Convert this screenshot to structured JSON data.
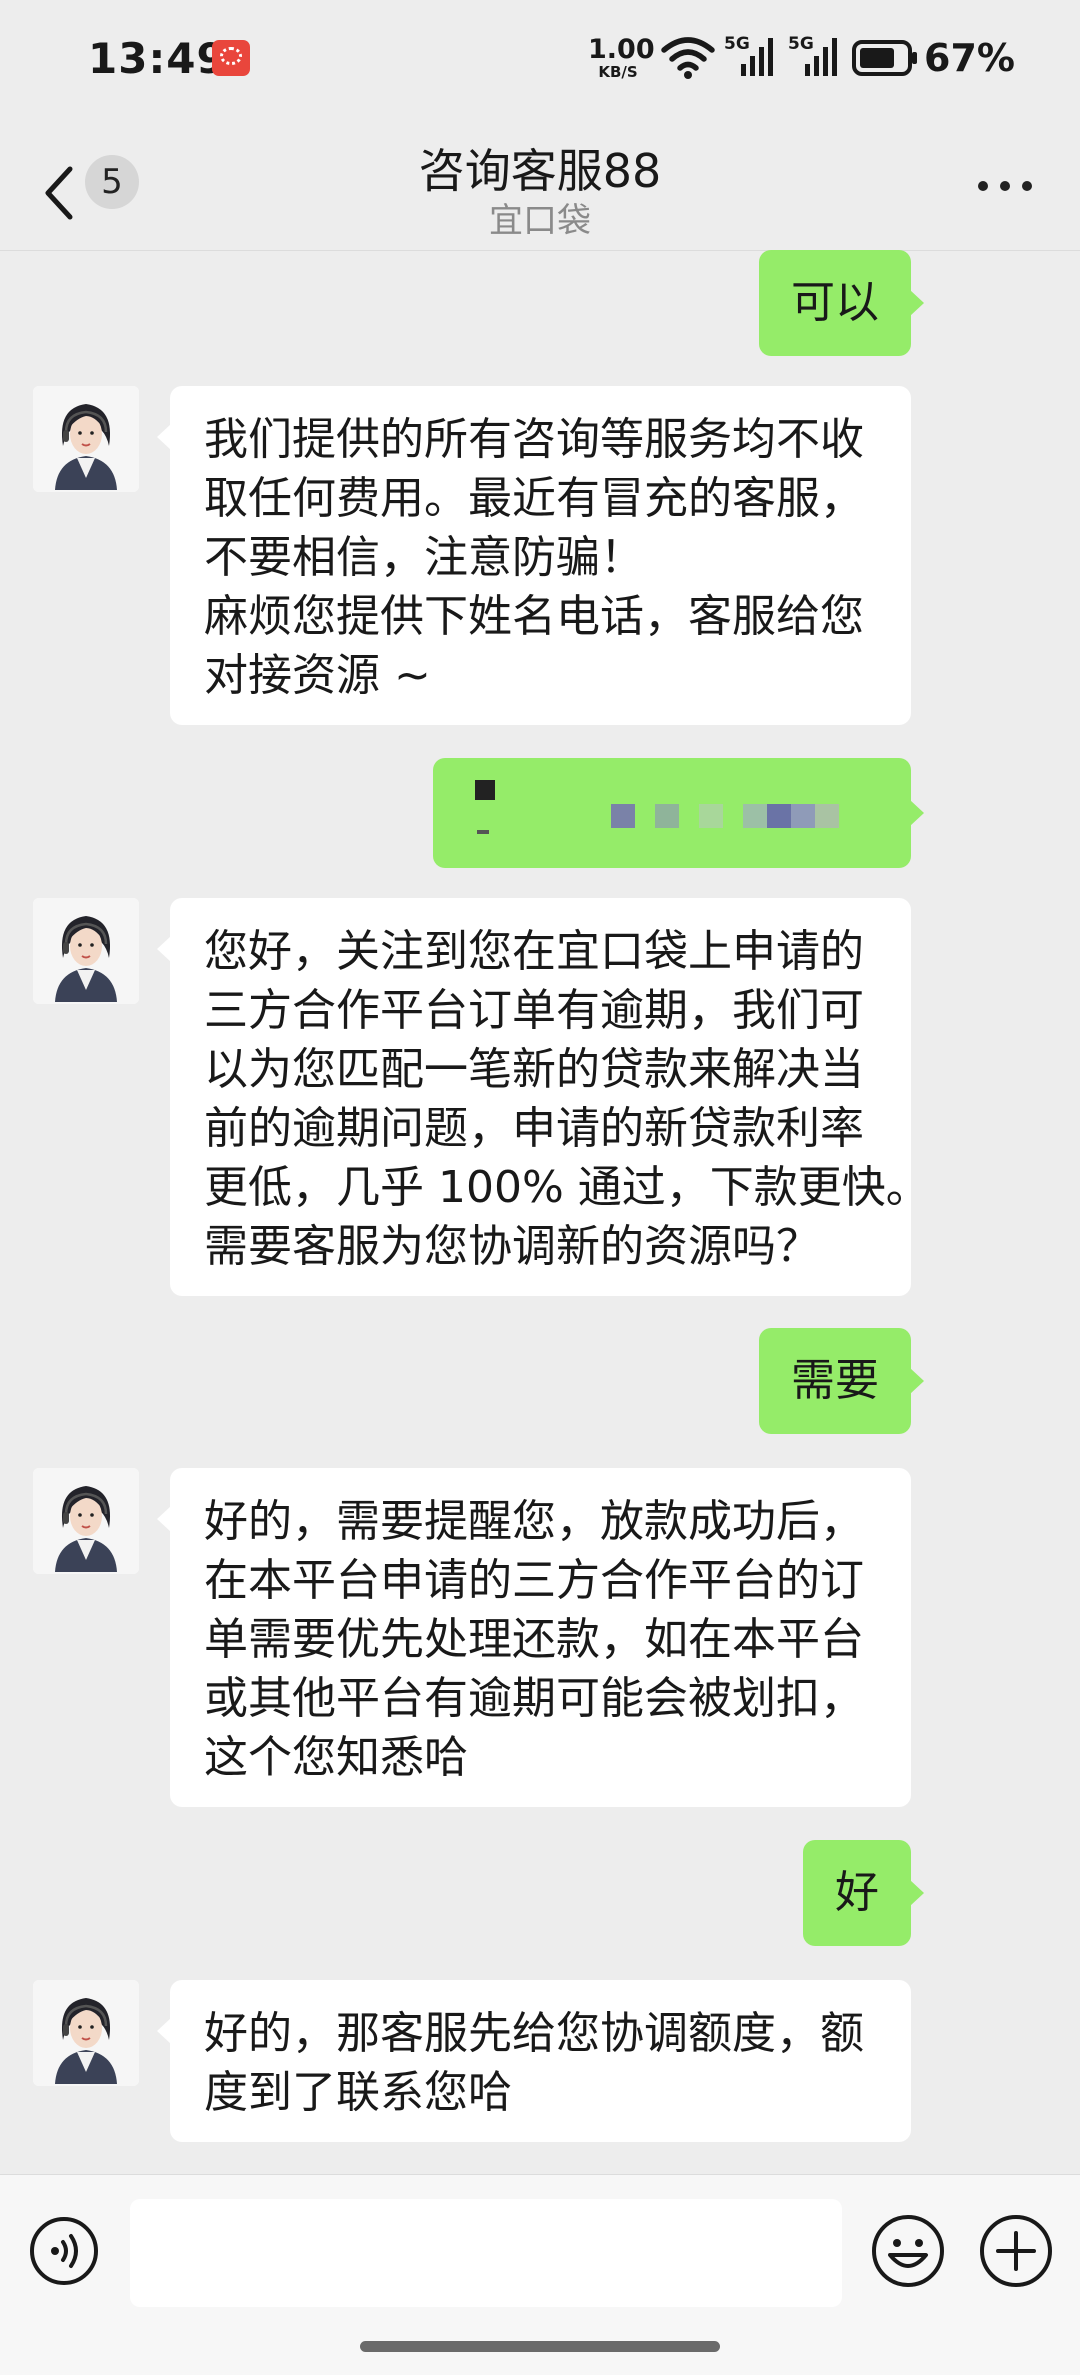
{
  "status_bar": {
    "time": "13:49",
    "net_speed_value": "1.00",
    "net_speed_unit": "KB/S",
    "signal_1_label": "5G",
    "signal_2_label": "5G",
    "battery_percent": "67%",
    "icons": [
      "app-notification-icon",
      "wifi-icon",
      "signal-icon",
      "signal-icon",
      "battery-icon"
    ]
  },
  "header": {
    "unread_count": "5",
    "title": "咨询客服88",
    "subtitle": "宜口袋",
    "icons": [
      "back-arrow-icon",
      "more-icon"
    ]
  },
  "messages": [
    {
      "from": "me",
      "text": "可以"
    },
    {
      "from": "agent",
      "lines": [
        "我们提供的所有咨询等服务均不收",
        "取任何费用。最近有冒充的客服，",
        "不要相信，注意防骗！",
        "麻烦您提供下姓名电话，客服给您",
        "对接资源 ~"
      ]
    },
    {
      "from": "me",
      "redacted": true
    },
    {
      "from": "agent",
      "lines": [
        "您好，关注到您在宜口袋上申请的",
        "三方合作平台订单有逾期，我们可",
        "以为您匹配一笔新的贷款来解决当",
        "前的逾期问题，申请的新贷款利率",
        "更低，几乎 100% 通过，下款更快。",
        "需要客服为您协调新的资源吗？"
      ]
    },
    {
      "from": "me",
      "text": "需要"
    },
    {
      "from": "agent",
      "lines": [
        "好的，需要提醒您，放款成功后，",
        "在本平台申请的三方合作平台的订",
        "单需要优先处理还款，如在本平台",
        "或其他平台有逾期可能会被划扣，",
        "这个您知悉哈"
      ]
    },
    {
      "from": "me",
      "text": "好"
    },
    {
      "from": "agent",
      "lines": [
        "好的，那客服先给您协调额度，额",
        "度到了联系您哈"
      ]
    }
  ],
  "input_bar": {
    "icons": [
      "voice-icon",
      "emoji-icon",
      "plus-icon"
    ]
  },
  "colors": {
    "background": "#ededed",
    "my_bubble": "#95ec69",
    "agent_bubble": "#ffffff"
  }
}
